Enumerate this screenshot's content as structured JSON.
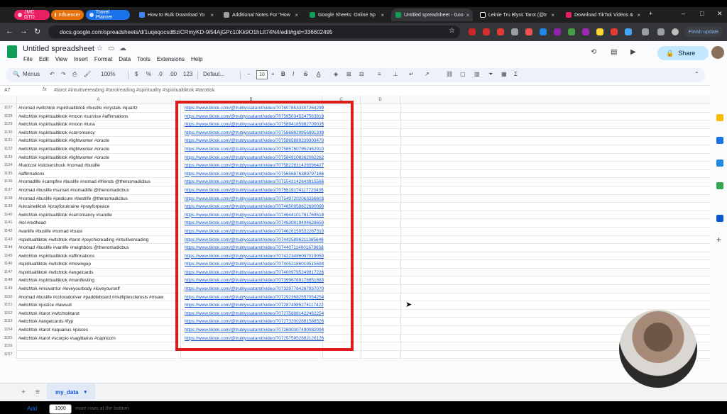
{
  "tabs": [
    {
      "label": "JMC GTD",
      "color": "#e91e63"
    },
    {
      "label": "Influencer",
      "color": "#e8710a"
    },
    {
      "label": "Travel Planner",
      "color": "#1a73e8"
    },
    {
      "label": "How to Bulk Download Yo",
      "fav": "#4285f4"
    },
    {
      "label": "Additional Notes For \"How",
      "fav": "#9aa0a6"
    },
    {
      "label": "Google Sheets: Online Sp",
      "fav": "#0f9d58"
    },
    {
      "label": "Untitled spreadsheet - Goo",
      "fav": "#0f9d58"
    },
    {
      "label": "Leinie Tru Blyss Tarot (@tr",
      "fav": "#000000"
    },
    {
      "label": "Download TikTok Videos &",
      "fav": "#e91e63"
    }
  ],
  "address": {
    "url": "docs.google.com/spreadsheets/d/1uqeqocsdBziCRmyKD-9i54AjGPc10Kk9O1hLtt74N4/edit#gid=336602495"
  },
  "browser": {
    "finish_update": "Finish update"
  },
  "doc": {
    "title": "Untitled spreadsheet",
    "menu": [
      "File",
      "Edit",
      "View",
      "Insert",
      "Format",
      "Data",
      "Tools",
      "Extensions",
      "Help"
    ],
    "share": "Share"
  },
  "toolbar": {
    "menus": "Menus",
    "zoom": "100%",
    "dollar": "$",
    "percent": "%",
    "dec_less": ".0",
    "dec_more": ".00",
    "num_fmt": "123",
    "font": "Defaul...",
    "font_size": "10"
  },
  "formula": {
    "cell_ref": "A7",
    "fx": "fx",
    "text": "#tarot #intuitivereading #tarotreading #spirituality #spiritualtiktok #tarottok"
  },
  "columns": [
    "A",
    "B",
    "C",
    "D"
  ],
  "rows": [
    {
      "n": "1127",
      "a": "#nomad #witchtok #spiritualtiktok #buslife #crystals #quartz",
      "b": "https://www.tiktok.com/@trublyssatarot/video/7076078533307264299"
    },
    {
      "n": "1128",
      "a": "#witchtok #spiritualtiktok #moon #sunrise #affirmations",
      "b": "https://www.tiktok.com/@trublyssatarot/video/7075950345347563819"
    },
    {
      "n": "1129",
      "a": "#witchtok #spiritualtiktok #moon #luna",
      "b": "https://www.tiktok.com/@trublyssatarot/video/7075894185982709035"
    },
    {
      "n": "1130",
      "a": "#witchtok #spiritualtiktok #carromancy",
      "b": "https://www.tiktok.com/@trublyssatarot/video/7075868620956991339"
    },
    {
      "n": "1131",
      "a": "#witchtok #spiritualtiktok #lightworker #oracle",
      "b": "https://www.tiktok.com/@trublyssatarot/video/7075865889239303470"
    },
    {
      "n": "1132",
      "a": "#witchtok #spiritualtiktok #lightworker #oracle",
      "b": "https://www.tiktok.com/@trublyssatarot/video/7075857607952462910"
    },
    {
      "n": "1133",
      "a": "#witchtok #spiritualtiktok #lightworker #oracle",
      "b": "https://www.tiktok.com/@trublyssatarot/video/7075849108362062262"
    },
    {
      "n": "1134",
      "a": "#fuelcost #stickershock #nomad #buslife",
      "b": "https://www.tiktok.com/@trublyssatarot/video/7075822831426096427"
    },
    {
      "n": "1135",
      "a": "#affirmations",
      "b": "https://www.tiktok.com/@trublyssatarot/video/7075656876389797166"
    },
    {
      "n": "1136",
      "a": "#nomadlife #campfire #buslife #nomad #friends @thenomadicbus",
      "b": "https://www.tiktok.com/@trublyssatarot/video/7075542142643915566"
    },
    {
      "n": "1137",
      "a": "#nomad #buslife #sunset #nomadlife @thenomadicbus",
      "b": "https://www.tiktok.com/@trublyssatarot/video/7075519174117723435"
    },
    {
      "n": "1138",
      "a": "#nomad #buslife #pedicure #bestlife @thenomadicbus",
      "b": "https://www.tiktok.com/@trublyssatarot/video/7075497202063336603"
    },
    {
      "n": "1139",
      "a": "#ukrainetiktok #prayforukraine #prayforpeace",
      "b": "https://www.tiktok.com/@trublyssatarot/video/7074650958822690090"
    },
    {
      "n": "1140",
      "a": "#witchtok #spiritualtiktok #carromancy #candle",
      "b": "https://www.tiktok.com/@trublyssatarot/video/7074644101781769518"
    },
    {
      "n": "1141",
      "a": "#lol #redhead",
      "b": "https://www.tiktok.com/@trublyssatarot/video/7074630819494628650"
    },
    {
      "n": "1142",
      "a": "#vanlife #buslife #nomad #toast",
      "b": "https://www.tiktok.com/@trublyssatarot/video/7074626150532267310"
    },
    {
      "n": "1143",
      "a": "#spiritualtiktok #witchtok #tarot #psychicreading #intuitivereading",
      "b": "https://www.tiktok.com/@trublyssatarot/video/7074425896211385646"
    },
    {
      "n": "1144",
      "a": "#nomad #buslife #vanlife #neighbors @thenomadicbus",
      "b": "https://www.tiktok.com/@trublyssatarot/video/7074407114001679658"
    },
    {
      "n": "1145",
      "a": "#witchtok #spiritualtiktok #affirmations",
      "b": "https://www.tiktok.com/@trublyssatarot/video/7074223486097019050"
    },
    {
      "n": "1146",
      "a": "#spiritualtiktok #witchtok #movingup",
      "b": "https://www.tiktok.com/@trublyssatarot/video/7074052186019515694"
    },
    {
      "n": "1147",
      "a": "#spiritualtiktok #witchtok #angelcards",
      "b": "https://www.tiktok.com/@trublyssatarot/video/7074009795249917226"
    },
    {
      "n": "1148",
      "a": "#witchtok #spiritualtiktok #manifesting",
      "b": "https://www.tiktok.com/@trublyssatarot/video/7073996789178851883"
    },
    {
      "n": "1149",
      "a": "#witchtok #mswarrior #loveyourbody #loveyourself",
      "b": "https://www.tiktok.com/@trublyssatarot/video/7073297764267937070"
    },
    {
      "n": "1150",
      "a": "#nomad #buslife #coloradoriver #paddleboard #multiplesclerosis #msaw",
      "b": "https://www.tiktok.com/@trublyssatarot/video/7072923682557054254"
    },
    {
      "n": "1151",
      "a": "#witchtok #justice #lawsuit",
      "b": "https://www.tiktok.com/@trublyssatarot/video/7072874985274117422"
    },
    {
      "n": "1152",
      "a": "#witchtok #tarot #witchtoktarot",
      "b": "https://www.tiktok.com/@trublyssatarot/video/7072758881422462254"
    },
    {
      "n": "1153",
      "a": "#witchtok #angelcards #fyp",
      "b": "https://www.tiktok.com/@trublyssatarot/video/7072732002881588526"
    },
    {
      "n": "1154",
      "a": "#witchtok #tarot #aquarius #pisces",
      "b": "https://www.tiktok.com/@trublyssatarot/video/7072600307490082094"
    },
    {
      "n": "1155",
      "a": "#witchtok #tarot #scorpio #sagittarius #capricorn",
      "b": "https://www.tiktok.com/@trublyssatarot/video/7072575952882126126"
    },
    {
      "n": "1156",
      "a": "",
      "b": ""
    },
    {
      "n": "1157",
      "a": "",
      "b": ""
    }
  ],
  "footer": {
    "add": "Add",
    "count": "1000",
    "suffix": "more rows at the bottom"
  },
  "sheet": {
    "tab": "my_data"
  }
}
